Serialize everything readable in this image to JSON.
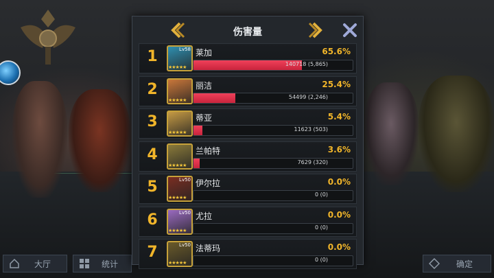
{
  "dialog": {
    "title": "伤害量",
    "rows": [
      {
        "rank": "1",
        "name": "莱加",
        "percent": "65.6%",
        "share": 65.6,
        "damage": "140718 (5,865)",
        "level": "Lv58",
        "avatar_color": "#2f8fb0"
      },
      {
        "rank": "2",
        "name": "丽洁",
        "percent": "25.4%",
        "share": 25.4,
        "damage": "54499 (2,246)",
        "level": "",
        "avatar_color": "#c9773a"
      },
      {
        "rank": "3",
        "name": "蒂亚",
        "percent": "5.4%",
        "share": 5.4,
        "damage": "11623 (503)",
        "level": "",
        "avatar_color": "#c59a44"
      },
      {
        "rank": "4",
        "name": "兰帕特",
        "percent": "3.6%",
        "share": 3.6,
        "damage": "7629 (320)",
        "level": "",
        "avatar_color": "#8a7a3a"
      },
      {
        "rank": "5",
        "name": "伊尔拉",
        "percent": "0.0%",
        "share": 0,
        "damage": "0 (0)",
        "level": "Lv50",
        "avatar_color": "#7a2e22"
      },
      {
        "rank": "6",
        "name": "尤拉",
        "percent": "0.0%",
        "share": 0,
        "damage": "0 (0)",
        "level": "Lv50",
        "avatar_color": "#9a6ac0"
      },
      {
        "rank": "7",
        "name": "法蒂玛",
        "percent": "0.0%",
        "share": 0,
        "damage": "0 (0)",
        "level": "Lv50",
        "avatar_color": "#6a5a2a"
      }
    ]
  },
  "nav": {
    "hall": "大厅",
    "stats": "统计",
    "confirm": "确定"
  },
  "colors": {
    "accent_gold": "#f1b52a",
    "bar_red": "#e0344e"
  }
}
